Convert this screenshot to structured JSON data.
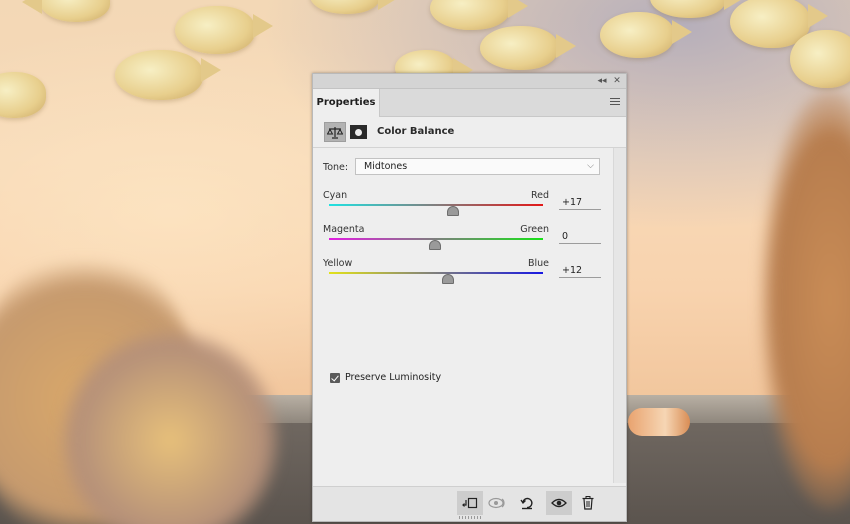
{
  "panel": {
    "tab_label": "Properties",
    "collapse_icon": "double-chevron-icon",
    "close_icon": "close-icon",
    "menu_icon": "panel-menu-icon"
  },
  "adjustment": {
    "title": "Color Balance",
    "adjustment_icon": "balance-scale-icon",
    "mask_icon": "layer-mask-icon"
  },
  "tone": {
    "label": "Tone:",
    "selected": "Midtones"
  },
  "sliders": [
    {
      "left_label": "Cyan",
      "right_label": "Red",
      "value": "+17",
      "gradient": [
        "#21e2e2",
        "#e21818"
      ]
    },
    {
      "left_label": "Magenta",
      "right_label": "Green",
      "value": "0",
      "gradient": [
        "#e21ee2",
        "#18e218"
      ]
    },
    {
      "left_label": "Yellow",
      "right_label": "Blue",
      "value": "+12",
      "gradient": [
        "#e2e21a",
        "#1818e2"
      ]
    }
  ],
  "preserve_luminosity": {
    "label": "Preserve Luminosity",
    "checked": true
  },
  "footer_icons": [
    "clip-to-layer-icon",
    "view-previous-state-icon",
    "reset-icon",
    "visibility-eye-icon",
    "delete-trash-icon"
  ]
}
